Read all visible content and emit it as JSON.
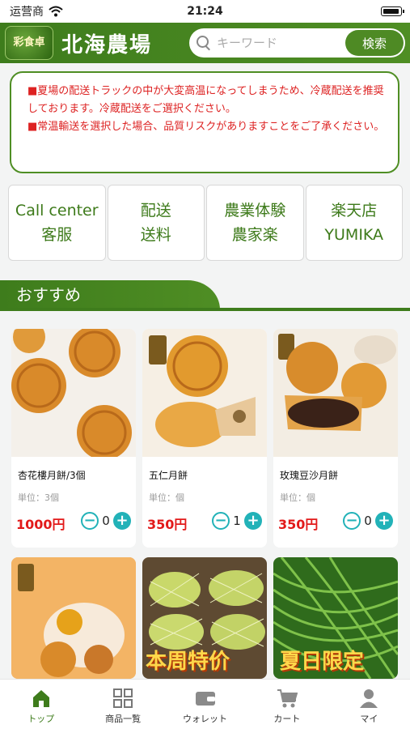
{
  "status_bar": {
    "carrier": "运营商",
    "time": "21:24"
  },
  "header": {
    "logo_badge": "彩食卓",
    "logo_text": "北海農場",
    "search_placeholder": "キーワード",
    "search_button": "検索"
  },
  "notice": {
    "line1": "■夏場の配送トラックの中が大変高温になってしまうため、冷蔵配送を推奨しております。冷蔵配送をご選択ください。",
    "line2": "■常温輸送を選択した場合、品質リスクがありますことをご了承ください。"
  },
  "quick_links": [
    {
      "line1": "Call center",
      "line2": "客服"
    },
    {
      "line1": "配送",
      "line2": "送料"
    },
    {
      "line1": "農業体験",
      "line2": "農家楽"
    },
    {
      "line1": "楽天店",
      "line2": "YUMIKA"
    }
  ],
  "section": {
    "title": "おすすめ"
  },
  "products": [
    {
      "name": "杏花樓月餅/3個",
      "unit": "単位：3個",
      "price": "1000円",
      "qty": "0",
      "image_icon": "mooncake-image"
    },
    {
      "name": "五仁月餅",
      "unit": "単位：個",
      "price": "350円",
      "qty": "1",
      "image_icon": "mooncake-image"
    },
    {
      "name": "玫瑰豆沙月餅",
      "unit": "単位：個",
      "price": "350円",
      "qty": "0",
      "image_icon": "mooncake-image"
    }
  ],
  "product_row2": [
    {
      "overlay": "",
      "image_icon": "mooncake-image"
    },
    {
      "overlay": "本周特价",
      "image_icon": "melon-image"
    },
    {
      "overlay": "夏日限定",
      "image_icon": "beans-image"
    }
  ],
  "tabbar": [
    {
      "label": "トップ",
      "icon": "home-icon",
      "active": true
    },
    {
      "label": "商品一覧",
      "icon": "grid-icon",
      "active": false
    },
    {
      "label": "ウォレット",
      "icon": "wallet-icon",
      "active": false
    },
    {
      "label": "カート",
      "icon": "cart-icon",
      "active": false
    },
    {
      "label": "マイ",
      "icon": "user-icon",
      "active": false
    }
  ],
  "colors": {
    "brand_green": "#3e7c1c",
    "price_red": "#e21a1a",
    "qty_teal": "#22b2b8",
    "notice_red": "#dd2222"
  }
}
